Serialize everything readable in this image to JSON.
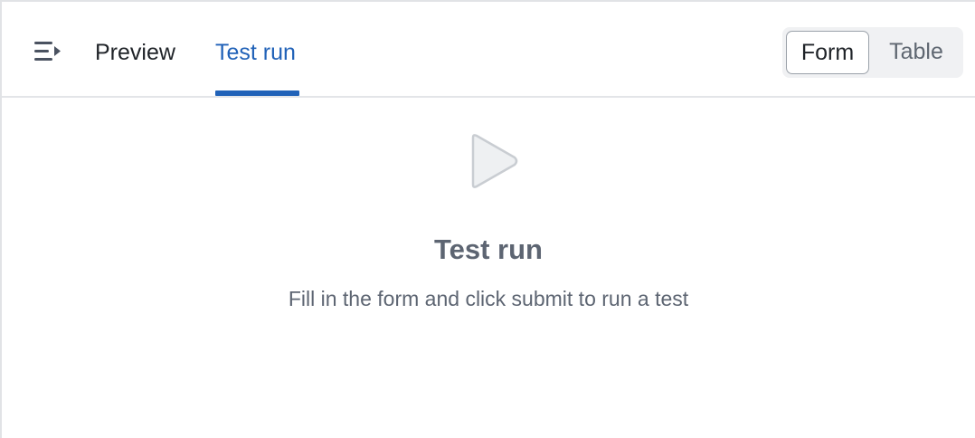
{
  "header": {
    "menu_icon": "menu-collapse-icon",
    "tabs": [
      {
        "label": "Preview",
        "active": false
      },
      {
        "label": "Test run",
        "active": true
      }
    ],
    "view_toggle": {
      "options": [
        "Form",
        "Table"
      ],
      "selected": "Form"
    }
  },
  "empty_state": {
    "icon": "play-icon",
    "title": "Test run",
    "subtitle": "Fill in the form and click submit to run a test"
  },
  "colors": {
    "accent": "#2162b8",
    "muted_text": "#5d6572",
    "border": "#e3e5e8",
    "toggle_bg": "#f0f1f3"
  }
}
